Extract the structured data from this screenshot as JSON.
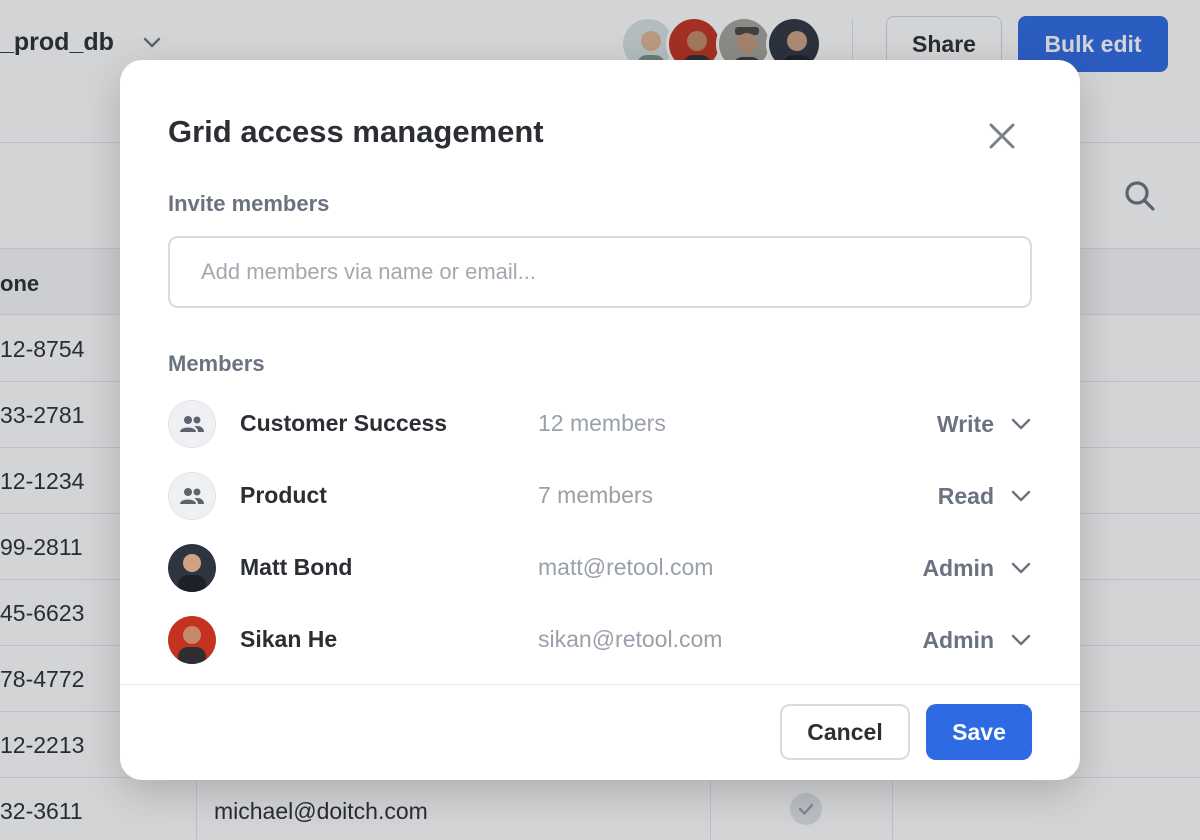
{
  "background": {
    "db_title": "_prod_db",
    "share_label": "Share",
    "bulk_edit_label": "Bulk edit",
    "column_header": "one",
    "rows": [
      {
        "phone": "12-8754",
        "email": ""
      },
      {
        "phone": "33-2781",
        "email": ""
      },
      {
        "phone": "12-1234",
        "email": ""
      },
      {
        "phone": "99-2811",
        "email": ""
      },
      {
        "phone": "45-6623",
        "email": ""
      },
      {
        "phone": "78-4772",
        "email": ""
      },
      {
        "phone": "12-2213",
        "email": ""
      },
      {
        "phone": "32-3611",
        "email": "michael@doitch.com"
      }
    ],
    "collaborator_avatars": [
      "avatar-1",
      "avatar-2",
      "avatar-3",
      "avatar-4"
    ]
  },
  "modal": {
    "title": "Grid access management",
    "invite_label": "Invite members",
    "invite_placeholder": "Add members via name or email...",
    "members_label": "Members",
    "members": [
      {
        "name": "Customer Success",
        "detail": "12 members",
        "role": "Write",
        "kind": "group"
      },
      {
        "name": "Product",
        "detail": "7 members",
        "role": "Read",
        "kind": "group"
      },
      {
        "name": "Matt Bond",
        "detail": "matt@retool.com",
        "role": "Admin",
        "kind": "user"
      },
      {
        "name": "Sikan He",
        "detail": "sikan@retool.com",
        "role": "Admin",
        "kind": "user"
      }
    ],
    "cancel_label": "Cancel",
    "save_label": "Save"
  },
  "colors": {
    "primary": "#2d6ae3",
    "overlay": "#22263033",
    "muted_text": "#6b7280"
  },
  "icons": [
    "chevron-down-icon",
    "search-icon",
    "close-icon",
    "group-icon",
    "check-icon"
  ]
}
